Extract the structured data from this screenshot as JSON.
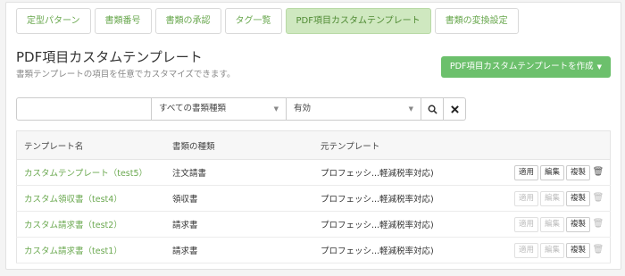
{
  "tabs": [
    {
      "label": "定型パターン"
    },
    {
      "label": "書類番号"
    },
    {
      "label": "書類の承認"
    },
    {
      "label": "タグ一覧"
    },
    {
      "label": "PDF項目カスタムテンプレート"
    },
    {
      "label": "書類の変換設定"
    }
  ],
  "header": {
    "title": "PDF項目カスタムテンプレート",
    "subtitle": "書類テンプレートの項目を任意でカスタマイズできます。",
    "create_button": "PDF項目カスタムテンプレートを作成"
  },
  "filter": {
    "search_value": "",
    "doc_type_selected": "すべての書類種類",
    "status_selected": "有効"
  },
  "table": {
    "headers": [
      "テンプレート名",
      "書類の種類",
      "元テンプレート"
    ],
    "rows": [
      {
        "name": "カスタムテンプレート（test5）",
        "type": "注文請書",
        "source": "プロフェッシ...軽減税率対応)",
        "apply": "適用",
        "edit": "編集",
        "copy": "複製",
        "edit_enabled": true,
        "delete_enabled": true
      },
      {
        "name": "カスタム領収書（test4）",
        "type": "領収書",
        "source": "プロフェッシ...軽減税率対応)",
        "apply": "適用",
        "edit": "編集",
        "copy": "複製",
        "edit_enabled": false,
        "delete_enabled": false
      },
      {
        "name": "カスタム請求書（test2）",
        "type": "請求書",
        "source": "プロフェッシ...軽減税率対応)",
        "apply": "適用",
        "edit": "編集",
        "copy": "複製",
        "edit_enabled": false,
        "delete_enabled": false
      },
      {
        "name": "カスタム請求書（test1）",
        "type": "請求書",
        "source": "プロフェッシ...軽減税率対応)",
        "apply": "適用",
        "edit": "編集",
        "copy": "複製",
        "edit_enabled": false,
        "delete_enabled": false
      }
    ]
  },
  "colors": {
    "accent": "#6aa84f",
    "button": "#6cc06c",
    "active_tab": "#cfe8c0"
  },
  "icons": {
    "search": "search-icon",
    "clear": "close-icon",
    "delete": "trash-icon"
  }
}
